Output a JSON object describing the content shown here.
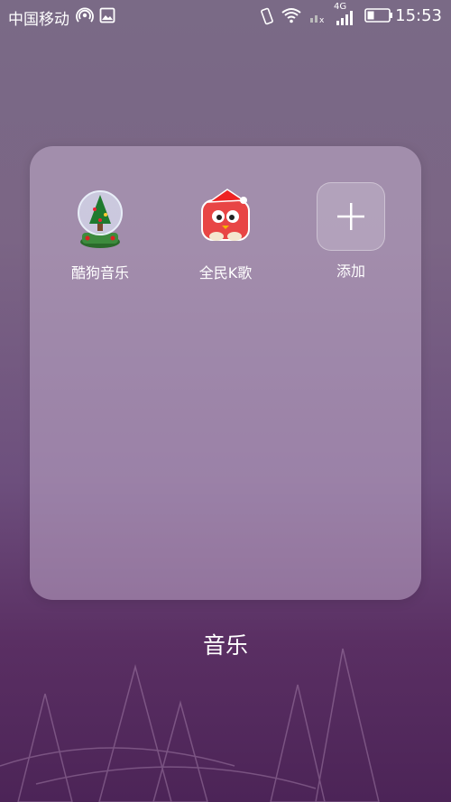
{
  "status_bar": {
    "carrier": "中国移动",
    "network": "4G",
    "time": "15:53",
    "icons": [
      "hotspot-icon",
      "image-icon",
      "vibrate-icon",
      "wifi-icon",
      "signal-muted-icon",
      "cellular-signal-icon",
      "battery-icon"
    ]
  },
  "folder": {
    "apps": [
      {
        "label": "酷狗音乐",
        "icon": "kugou-music-icon"
      },
      {
        "label": "全民K歌",
        "icon": "quanmin-kge-icon"
      },
      {
        "label": "添加",
        "icon": "add-icon"
      }
    ],
    "title": "音乐"
  },
  "colors": {
    "background_top": "#7a6a86",
    "background_bottom": "#4c2457",
    "panel": "#b9a6c6",
    "text": "#ffffff"
  }
}
